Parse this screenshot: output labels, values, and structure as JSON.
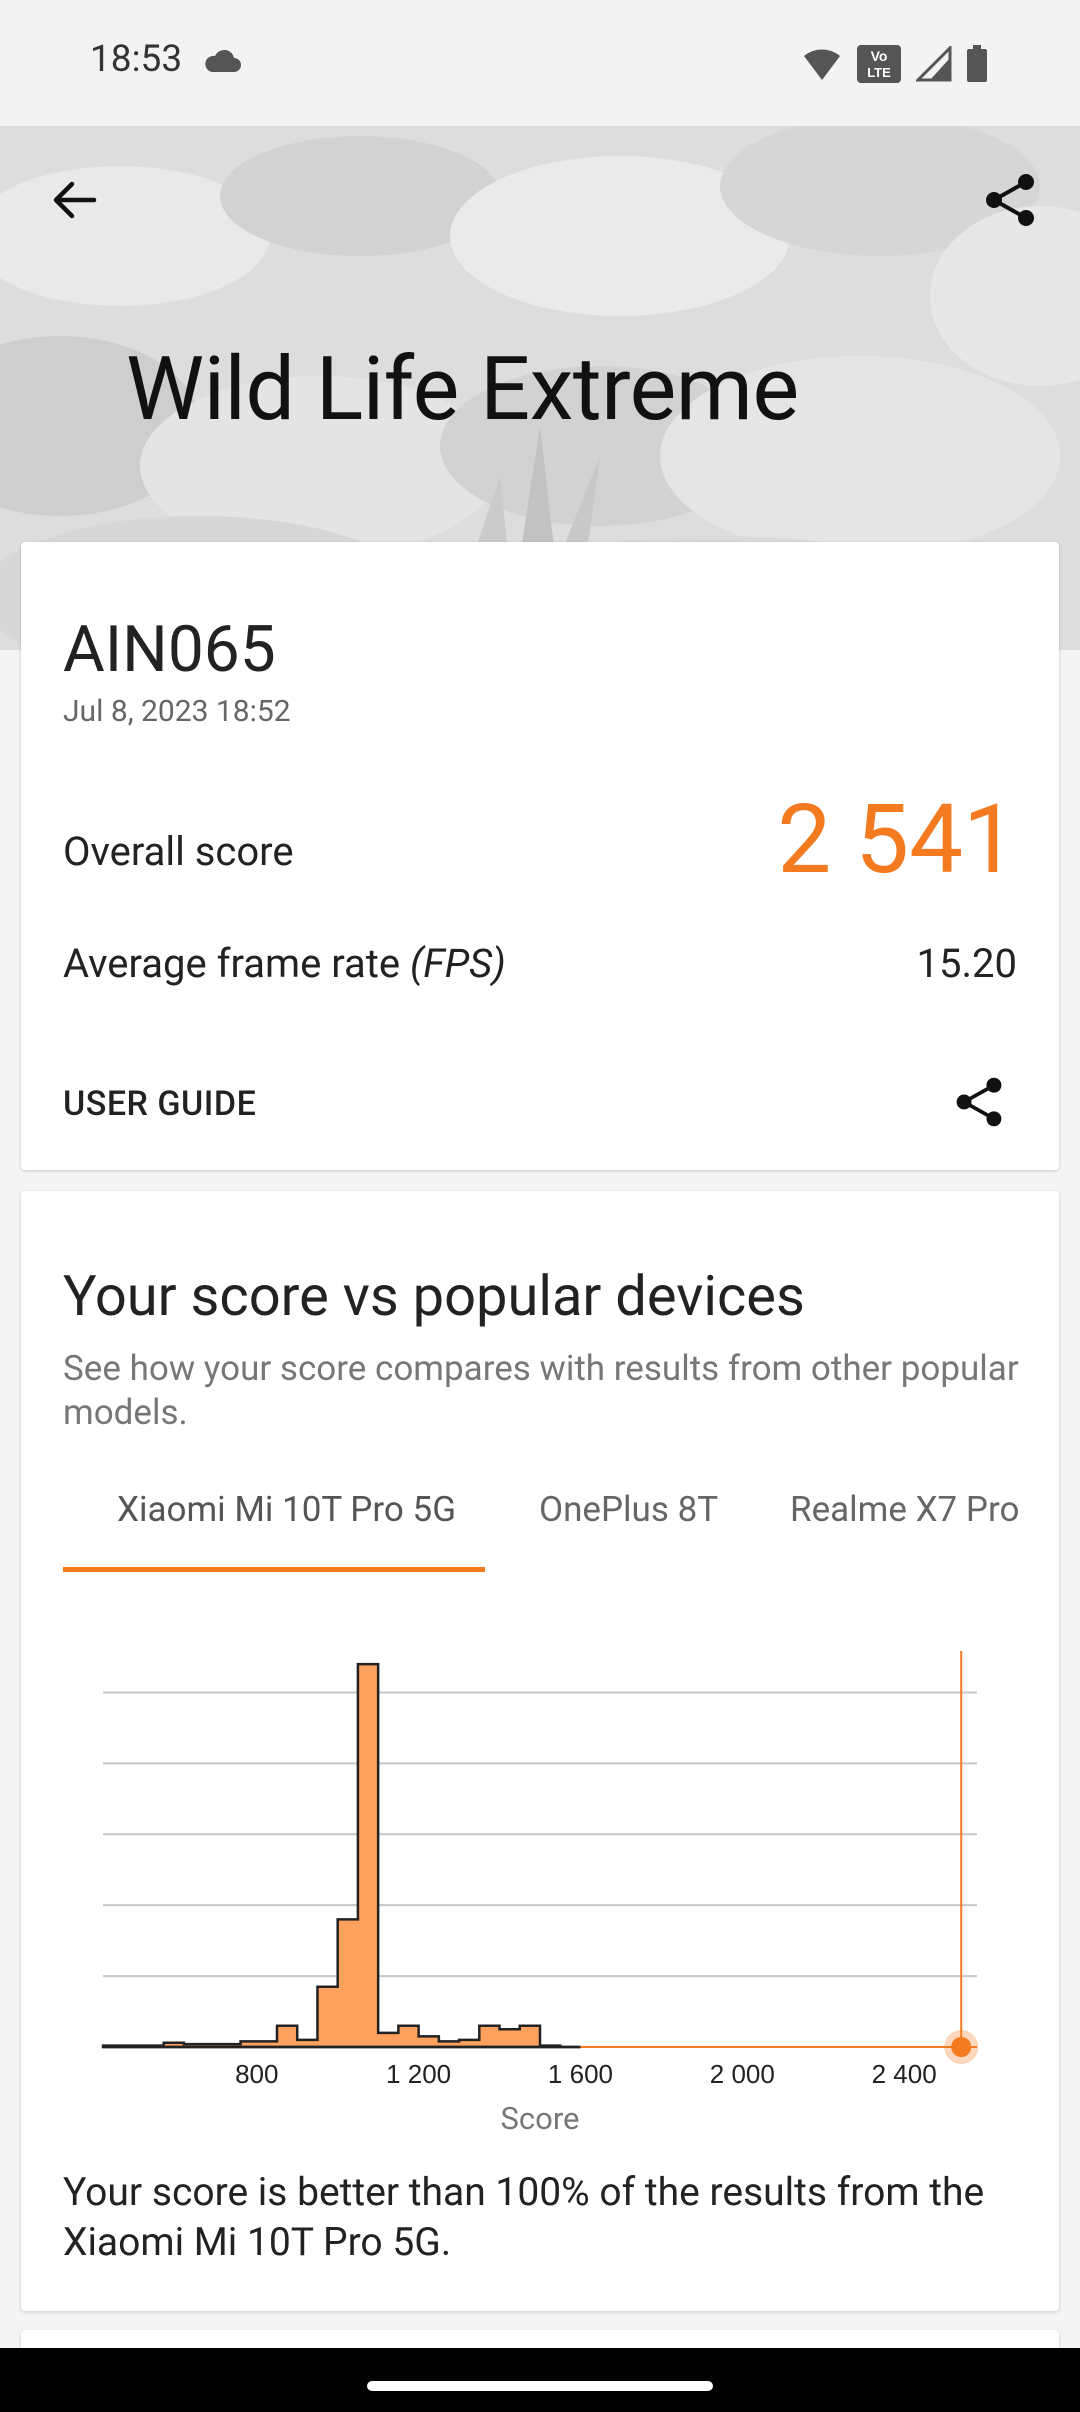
{
  "status_bar": {
    "time": "18:53",
    "volte": "Vo\nLTE"
  },
  "header": {
    "title": "Wild Life Extreme"
  },
  "result_card": {
    "device": "AIN065",
    "date": "Jul 8, 2023 18:52",
    "overall_label": "Overall score",
    "overall_value": "2 541",
    "fps_label": "Average frame rate ",
    "fps_unit": "(FPS)",
    "fps_value": "15.20",
    "user_guide": "USER GUIDE"
  },
  "comparison": {
    "title": "Your score vs popular devices",
    "subtitle": "See how your score compares with results from other popular models.",
    "tabs": [
      "Xiaomi Mi 10T Pro 5G",
      "OnePlus 8T",
      "Realme X7 Pro"
    ],
    "active_tab": 0,
    "x_axis_title": "Score",
    "result_text": "Your score is better than 100% of the results from the Xiaomi Mi 10T Pro 5G."
  },
  "colors": {
    "accent": "#f47a20",
    "histogram_fill": "#fda15f",
    "grid": "#c8c8c8"
  },
  "chart_data": {
    "type": "area",
    "xlabel": "Score",
    "xlim": [
      420,
      2580
    ],
    "ylim": [
      0,
      5.5
    ],
    "x_ticks": [
      800,
      1200,
      1600,
      2000,
      2400
    ],
    "x_tick_labels": [
      "800",
      "1 200",
      "1 600",
      "2 000",
      "2 400"
    ],
    "grid": true,
    "histogram": {
      "bin_edges": [
        420,
        570,
        620,
        760,
        850,
        900,
        950,
        1000,
        1050,
        1100,
        1150,
        1200,
        1250,
        1300,
        1350,
        1400,
        1450,
        1500,
        1550,
        1600
      ],
      "values": [
        0.02,
        0.06,
        0.04,
        0.08,
        0.3,
        0.1,
        0.85,
        1.8,
        5.4,
        0.2,
        0.3,
        0.15,
        0.08,
        0.1,
        0.3,
        0.25,
        0.3,
        0.02,
        0
      ]
    },
    "your_score": 2541
  }
}
